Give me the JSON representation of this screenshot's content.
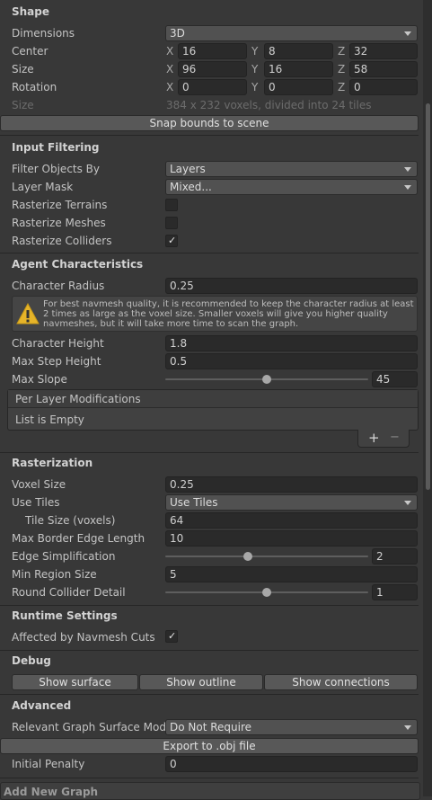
{
  "shape": {
    "header": "Shape",
    "dimensions_label": "Dimensions",
    "dimensions_value": "3D",
    "center_label": "Center",
    "center": {
      "x": "16",
      "y": "8",
      "z": "32"
    },
    "size_label": "Size",
    "size": {
      "x": "96",
      "y": "16",
      "z": "58"
    },
    "rotation_label": "Rotation",
    "rotation": {
      "x": "0",
      "y": "0",
      "z": "0"
    },
    "axis_x": "X",
    "axis_y": "Y",
    "axis_z": "Z",
    "voxel_size_label": "Size",
    "voxel_info": "384 x 232 voxels, divided into 24 tiles",
    "snap_button": "Snap bounds to scene"
  },
  "input_filtering": {
    "header": "Input Filtering",
    "filter_label": "Filter Objects By",
    "filter_value": "Layers",
    "layer_mask_label": "Layer Mask",
    "layer_mask_value": "Mixed...",
    "rasterize_terrains_label": "Rasterize Terrains",
    "rasterize_terrains": false,
    "rasterize_meshes_label": "Rasterize Meshes",
    "rasterize_meshes": false,
    "rasterize_colliders_label": "Rasterize Colliders",
    "rasterize_colliders": true,
    "check_glyph": "✓"
  },
  "agent": {
    "header": "Agent Characteristics",
    "radius_label": "Character Radius",
    "radius_value": "0.25",
    "warning_text": "For best navmesh quality, it is recommended to keep the character radius at least 2 times as large as the voxel size. Smaller voxels will give you higher quality navmeshes, but it will take more time to scan the graph.",
    "height_label": "Character Height",
    "height_value": "1.8",
    "step_label": "Max Step Height",
    "step_value": "0.5",
    "slope_label": "Max Slope",
    "slope_value": "45",
    "slope_fraction": 0.5,
    "per_layer_label": "Per Layer Modifications",
    "list_empty": "List is Empty",
    "plus": "+",
    "minus": "−"
  },
  "rasterization": {
    "header": "Rasterization",
    "voxel_label": "Voxel Size",
    "voxel_value": "0.25",
    "use_tiles_label": "Use Tiles",
    "use_tiles_value": "Use Tiles",
    "tile_size_label": "Tile Size (voxels)",
    "tile_size_value": "64",
    "border_label": "Max Border Edge Length",
    "border_value": "10",
    "edge_simp_label": "Edge Simplification",
    "edge_simp_value": "2",
    "edge_simp_fraction": 0.4,
    "min_region_label": "Min Region Size",
    "min_region_value": "5",
    "round_label": "Round Collider Detail",
    "round_value": "1",
    "round_fraction": 0.5
  },
  "runtime": {
    "header": "Runtime Settings",
    "cuts_label": "Affected by Navmesh Cuts",
    "cuts_value": true
  },
  "debug": {
    "header": "Debug",
    "show_surface": "Show surface",
    "show_outline": "Show outline",
    "show_connections": "Show connections"
  },
  "advanced": {
    "header": "Advanced",
    "surface_mode_label": "Relevant Graph Surface Mode",
    "surface_mode_value": "Do Not Require",
    "export_button": "Export to .obj file",
    "penalty_label": "Initial Penalty",
    "penalty_value": "0"
  },
  "footer": {
    "add_new_graph": "Add New Graph"
  }
}
